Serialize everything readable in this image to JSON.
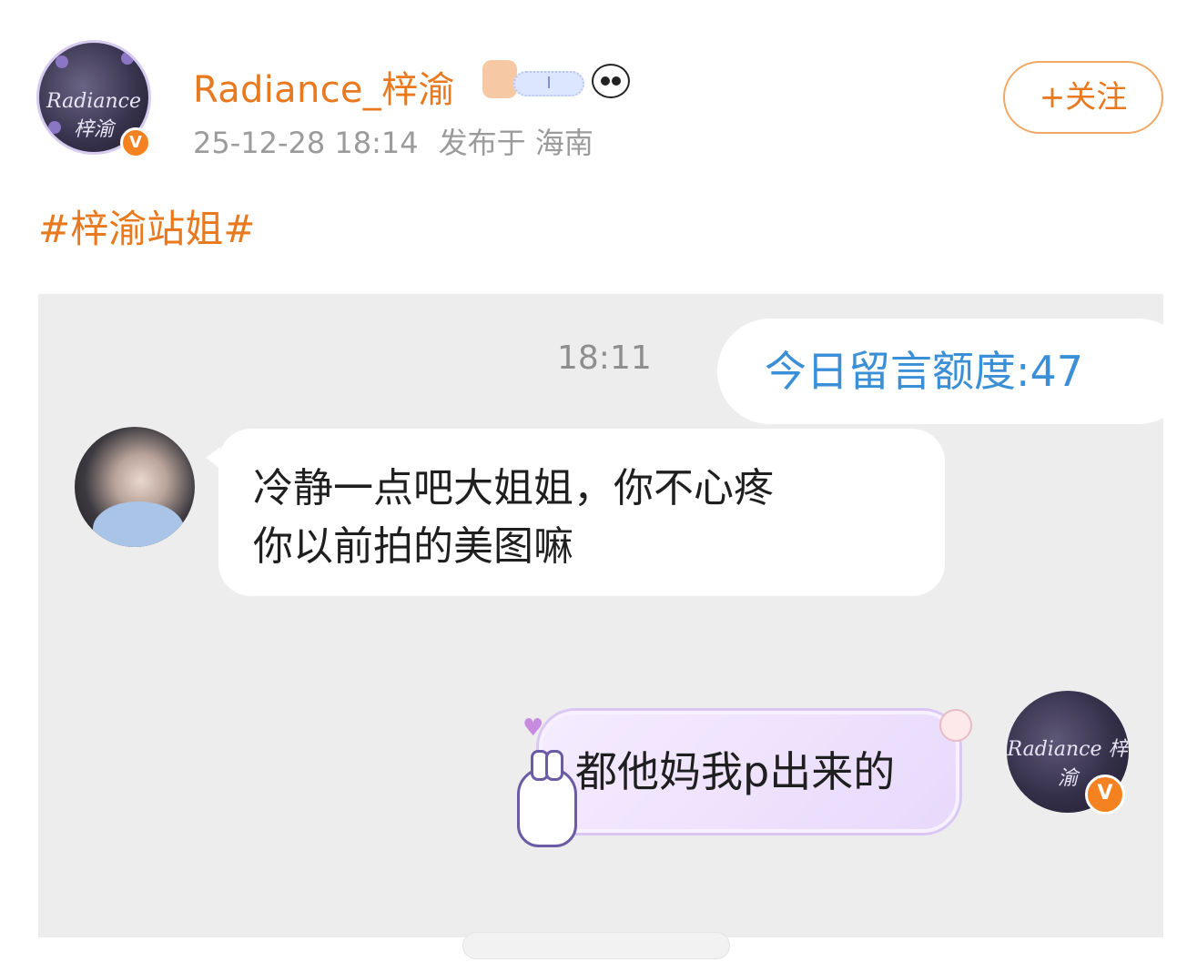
{
  "post": {
    "username": "Radiance_梓渝",
    "timestamp": "25-12-28 18:14",
    "location_text": "发布于 海南",
    "follow_label": "+关注",
    "hashtag": "#梓渝站姐#",
    "avatar_logo_text": "Radiance 梓渝",
    "verified_mark": "V",
    "badges": {
      "pill_text": "I"
    }
  },
  "chat": {
    "time": "18:11",
    "quota_message": "今日留言额度:47",
    "messages": [
      {
        "side": "left",
        "lines": [
          "冷静一点吧大姐姐，你不心疼",
          "你以前拍的美图嘛"
        ]
      },
      {
        "side": "right",
        "text": "都他妈我p出来的"
      }
    ],
    "right_avatar_logo_text": "Radiance 梓渝",
    "right_verified_mark": "V"
  },
  "colors": {
    "accent_orange": "#e8791e",
    "link_blue": "#3b8fd6",
    "chat_background": "#ededed",
    "meta_gray": "#9b9b9b"
  },
  "icons": [
    "verified-icon",
    "bear-badge-icon",
    "panda-badge-icon",
    "heart-icon",
    "paw-icon",
    "bunny-icon"
  ]
}
